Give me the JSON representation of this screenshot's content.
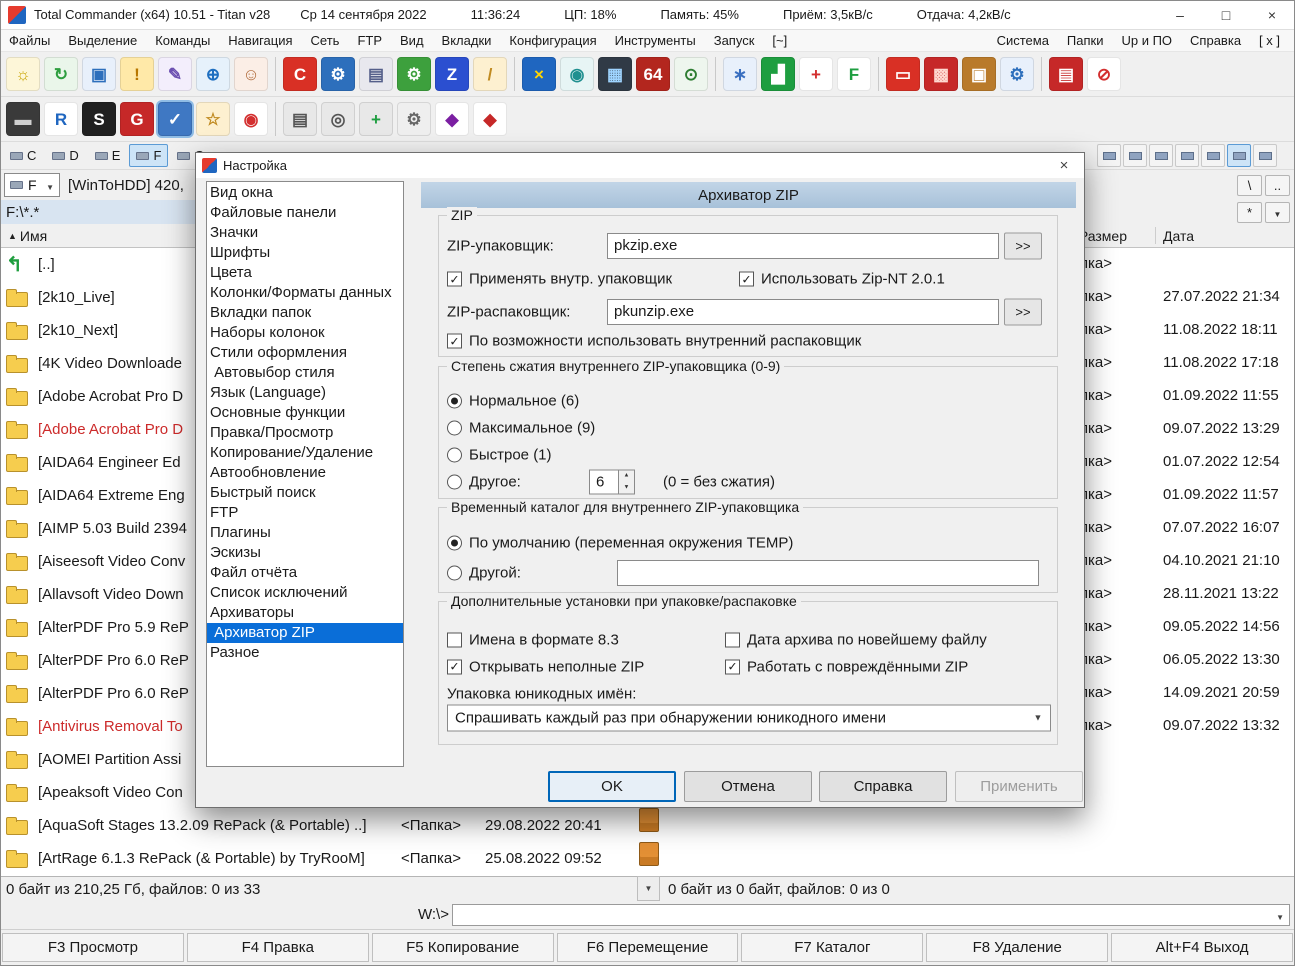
{
  "colors": {
    "accent": "#0a6ed8",
    "selection_bg": "#0a6ed8",
    "dialog_header": "#aec6dc",
    "folder_yellow": "#f6cd4e",
    "red_item": "#cc2a2a"
  },
  "titlebar": {
    "title": "Total Commander (x64) 10.51 - Titan v28",
    "date": "Ср 14 сентября 2022",
    "time": "11:36:24",
    "cpu": "ЦП: 18%",
    "memory": "Память: 45%",
    "rx": "Приём: 3,5кВ/с",
    "tx": "Отдача: 4,2кВ/с",
    "minimize": "–",
    "maximize": "□",
    "close": "×"
  },
  "menubar": {
    "left": [
      "Файлы",
      "Выделение",
      "Команды",
      "Навигация",
      "Сеть",
      "FTP",
      "Вид",
      "Вкладки",
      "Конфигурация",
      "Инструменты",
      "Запуск",
      "[~]"
    ],
    "right": [
      "Система",
      "Папки",
      "Up и ПО",
      "Справка",
      "[ x ]"
    ]
  },
  "toolbar1": [
    {
      "name": "lightbulb-icon",
      "glyph": "☼",
      "bg": "#fdf6d8",
      "fg": "#c9a400"
    },
    {
      "name": "refresh-icon",
      "glyph": "↻",
      "bg": "#eaf6ea",
      "fg": "#2e9e3f"
    },
    {
      "name": "monitor-icon",
      "glyph": "▣",
      "bg": "#e8f0fb",
      "fg": "#2d6fbc"
    },
    {
      "name": "shield-warning-icon",
      "glyph": "!",
      "bg": "#ffe9a8",
      "fg": "#b87700"
    },
    {
      "name": "pen-icon",
      "glyph": "✎",
      "bg": "#f3eefc",
      "fg": "#6b4fb0"
    },
    {
      "name": "globe-icon",
      "glyph": "⊕",
      "bg": "#e6f1fb",
      "fg": "#1f6fc0"
    },
    {
      "name": "user-icon",
      "glyph": "☺",
      "bg": "#fbeee6",
      "fg": "#b06a3a"
    },
    {
      "name": "ccleaner-icon",
      "glyph": "C",
      "bg": "#d93025",
      "fg": "#ffffff",
      "sep": true
    },
    {
      "name": "gear-blue-icon",
      "glyph": "⚙",
      "bg": "#2d6fbc",
      "fg": "#ffffff"
    },
    {
      "name": "printer-icon",
      "glyph": "▤",
      "bg": "#e8e8ee",
      "fg": "#555f8a"
    },
    {
      "name": "green-tool-icon",
      "glyph": "⚙",
      "bg": "#3da03d",
      "fg": "#ffffff"
    },
    {
      "name": "zip-z-icon",
      "glyph": "Z",
      "bg": "#2b4fd0",
      "fg": "#ffffff"
    },
    {
      "name": "broom-icon",
      "glyph": "/",
      "bg": "#fdf0d0",
      "fg": "#c08a20"
    },
    {
      "name": "block-x-icon",
      "glyph": "×",
      "bg": "#1f66c0",
      "fg": "#ffd400",
      "sep": true
    },
    {
      "name": "gauge-icon",
      "glyph": "◉",
      "bg": "#e7f5f5",
      "fg": "#1f8f8f"
    },
    {
      "name": "cpu-chip-icon",
      "glyph": "▦",
      "bg": "#303a46",
      "fg": "#9fd4ff"
    },
    {
      "name": "aida64-icon",
      "glyph": "64",
      "bg": "#b3261e",
      "fg": "#ffffff"
    },
    {
      "name": "hardware-search-icon",
      "glyph": "⊙",
      "bg": "#eef6ee",
      "fg": "#2e7d32"
    },
    {
      "name": "wand-icon",
      "glyph": "∗",
      "bg": "#e8f0fb",
      "fg": "#3a6fc0",
      "sep": true
    },
    {
      "name": "bar-chart-icon",
      "glyph": "▟",
      "bg": "#1e9e40",
      "fg": "#ffffff"
    },
    {
      "name": "medical-cross-icon",
      "glyph": "+",
      "bg": "#ffffff",
      "fg": "#d32f2f"
    },
    {
      "name": "letter-f-icon",
      "glyph": "F",
      "bg": "#ffffff",
      "fg": "#1e9e40"
    },
    {
      "name": "red-panel-icon",
      "glyph": "▭",
      "bg": "#d93025",
      "fg": "#ffffff",
      "sep": true
    },
    {
      "name": "red-blocks-icon",
      "glyph": "▩",
      "bg": "#c62828",
      "fg": "#ffd8d0"
    },
    {
      "name": "toolbox-icon",
      "glyph": "▣",
      "bg": "#b97a2a",
      "fg": "#ffffff"
    },
    {
      "name": "gears-pair-icon",
      "glyph": "⚙",
      "bg": "#e8f0fb",
      "fg": "#2d6fbc"
    },
    {
      "name": "brick-wall-icon",
      "glyph": "▤",
      "bg": "#c62828",
      "fg": "#ffffff",
      "sep": true
    },
    {
      "name": "no-entry-icon",
      "glyph": "⊘",
      "bg": "#ffffff",
      "fg": "#d32f2f"
    }
  ],
  "toolbar2": [
    {
      "name": "dark-case-icon",
      "glyph": "▬",
      "bg": "#3a3a3a",
      "fg": "#d0d0d0"
    },
    {
      "name": "r-studio-icon",
      "glyph": "R",
      "bg": "#ffffff",
      "fg": "#1f66c0"
    },
    {
      "name": "sd-tool-icon",
      "glyph": "S",
      "bg": "#202020",
      "fg": "#ffffff"
    },
    {
      "name": "g-red-icon",
      "glyph": "G",
      "bg": "#c62828",
      "fg": "#ffffff"
    },
    {
      "name": "check-panel-icon",
      "glyph": "✓",
      "bg": "#3f78c3",
      "fg": "#ffffff",
      "pressed": true
    },
    {
      "name": "sparkle-wand-icon",
      "glyph": "☆",
      "bg": "#fdf0d0",
      "fg": "#c08a20"
    },
    {
      "name": "orbs-icon",
      "glyph": "◉",
      "bg": "#ffffff",
      "fg": "#d32f2f"
    },
    {
      "name": "drives-icon",
      "glyph": "▤",
      "bg": "#e8e8e8",
      "fg": "#555555",
      "sep": true
    },
    {
      "name": "drive-disc-icon",
      "glyph": "◎",
      "bg": "#e8e8e8",
      "fg": "#555555"
    },
    {
      "name": "drive-add-icon",
      "glyph": "+",
      "bg": "#e8e8e8",
      "fg": "#1e9e40"
    },
    {
      "name": "gray-gears-icon",
      "glyph": "⚙",
      "bg": "#efefef",
      "fg": "#666666"
    },
    {
      "name": "color-cube-icon",
      "glyph": "◆",
      "bg": "#ffffff",
      "fg": "#7b1fa2"
    },
    {
      "name": "red-stack-icon",
      "glyph": "◆",
      "bg": "#ffffff",
      "fg": "#c62828"
    }
  ],
  "drivebar": {
    "drives": [
      {
        "letter": "C",
        "name": "drive-c-button"
      },
      {
        "letter": "D",
        "name": "drive-d-button"
      },
      {
        "letter": "E",
        "name": "drive-e-button"
      },
      {
        "letter": "F",
        "name": "drive-f-button",
        "active": true
      },
      {
        "letter": "G",
        "name": "drive-g-button"
      }
    ],
    "right_buttons": [
      {},
      {},
      {},
      {},
      {},
      {
        "active": true
      },
      {}
    ]
  },
  "left_panel": {
    "drive": "F",
    "drive_info": "[WinToHDD] 420,",
    "path": "F:\\*.*",
    "header": {
      "sort": "▲",
      "name": "Имя"
    },
    "rows": [
      {
        "updir": true,
        "name": "[..]",
        "size": "",
        "date": ""
      },
      {
        "name": "[2k10_Live]",
        "size": "",
        "date": ""
      },
      {
        "name": "[2k10_Next]",
        "size": "",
        "date": ""
      },
      {
        "name": "[4K Video Downloade",
        "size": "",
        "date": ""
      },
      {
        "name": "[Adobe Acrobat Pro D",
        "size": "",
        "date": ""
      },
      {
        "name": "[Adobe Acrobat Pro D",
        "red": true,
        "size": "",
        "date": ""
      },
      {
        "name": "[AIDA64 Engineer Ed",
        "size": "",
        "date": ""
      },
      {
        "name": "[AIDA64 Extreme Eng",
        "size": "",
        "date": ""
      },
      {
        "name": "[AIMP 5.03 Build 2394",
        "size": "",
        "date": ""
      },
      {
        "name": "[Aiseesoft Video Conv",
        "size": "",
        "date": ""
      },
      {
        "name": "[Allavsoft Video Down",
        "size": "",
        "date": ""
      },
      {
        "name": "[AlterPDF Pro 5.9 ReP",
        "size": "",
        "date": ""
      },
      {
        "name": "[AlterPDF Pro 6.0 ReP",
        "size": "",
        "date": ""
      },
      {
        "name": "[AlterPDF Pro 6.0 ReP",
        "size": "",
        "date": ""
      },
      {
        "name": "[Antivirus Removal To",
        "red": true,
        "size": "",
        "date": ""
      },
      {
        "name": "[AOMEI Partition Assi",
        "size": "",
        "date": ""
      },
      {
        "name": "[Apeaksoft Video Con",
        "size": "",
        "date": ""
      },
      {
        "name": "[AquaSoft Stages 13.2.09 RePack (& Portable) ..]",
        "size": "<Папка>",
        "date": "29.08.2022 20:41"
      },
      {
        "name": "[ArtRage 6.1.3 RePack (& Portable) by TryRooM]",
        "size": "<Папка>",
        "date": "25.08.2022 09:52"
      }
    ],
    "status": "0 байт из 210,25 Гб, файлов: 0 из 33"
  },
  "right_panel": {
    "root_btn": "\\",
    "up_btn": "..",
    "fav_btn": "*",
    "header": {
      "size": "Размер",
      "date": "Дата"
    },
    "rows": [
      {
        "size": "<Папка>",
        "date": ""
      },
      {
        "size": "<Папка>",
        "date": "27.07.2022 21:34"
      },
      {
        "size": "<Папка>",
        "date": "11.08.2022 18:11"
      },
      {
        "size": "<Папка>",
        "date": "11.08.2022 17:18"
      },
      {
        "size": "<Папка>",
        "date": "01.09.2022 11:55"
      },
      {
        "size": "<Папка>",
        "date": "09.07.2022 13:29"
      },
      {
        "size": "<Папка>",
        "date": "01.07.2022 12:54"
      },
      {
        "size": "<Папка>",
        "date": "01.09.2022 11:57"
      },
      {
        "size": "<Папка>",
        "date": "07.07.2022 16:07"
      },
      {
        "size": "<Папка>",
        "date": "04.10.2021 21:10"
      },
      {
        "size": "<Папка>",
        "date": "28.11.2021 13:22"
      },
      {
        "size": "<Папка>",
        "date": "09.05.2022 14:56"
      },
      {
        "size": "<Папка>",
        "date": "06.05.2022 13:30"
      },
      {
        "size": "<Папка>",
        "date": "14.09.2021 20:59"
      },
      {
        "size": "<Папка>",
        "date": "09.07.2022 13:32"
      }
    ],
    "status": "0 байт из 0 байт, файлов: 0 из 0"
  },
  "cmdline": {
    "prompt": "W:\\>",
    "value": ""
  },
  "fkeys": [
    "F3 Просмотр",
    "F4 Правка",
    "F5 Копирование",
    "F6 Перемещение",
    "F7 Каталог",
    "F8 Удаление",
    "Alt+F4 Выход"
  ],
  "dialog": {
    "title": "Настройка",
    "close": "×",
    "header": "Архиватор ZIP",
    "categories": [
      {
        "label": "Вид окна"
      },
      {
        "label": "Файловые панели"
      },
      {
        "label": "Значки"
      },
      {
        "label": "Шрифты"
      },
      {
        "label": "Цвета"
      },
      {
        "label": "Колонки/Форматы данных"
      },
      {
        "label": "Вкладки папок"
      },
      {
        "label": "Наборы колонок"
      },
      {
        "label": "Стили оформления"
      },
      {
        "label": " Автовыбор стиля"
      },
      {
        "label": "Язык (Language)"
      },
      {
        "label": "Основные функции"
      },
      {
        "label": "Правка/Просмотр"
      },
      {
        "label": "Копирование/Удаление"
      },
      {
        "label": "Автообновление"
      },
      {
        "label": "Быстрый поиск"
      },
      {
        "label": "FTP"
      },
      {
        "label": "Плагины"
      },
      {
        "label": "Эскизы"
      },
      {
        "label": "Файл отчёта"
      },
      {
        "label": "Список исключений"
      },
      {
        "label": "Архиваторы"
      },
      {
        "label": " Архиватор ZIP",
        "selected": true
      },
      {
        "label": "Разное"
      }
    ],
    "zip_group": {
      "legend": "ZIP",
      "packer_label": "ZIP-упаковщик:",
      "packer_value": "pkzip.exe",
      "browse": ">>",
      "use_internal_packer": {
        "label": "Применять внутр. упаковщик",
        "checked": true
      },
      "use_zipnt": {
        "label": "Использовать Zip-NT 2.0.1",
        "checked": true
      },
      "unpacker_label": "ZIP-распаковщик:",
      "unpacker_value": "pkunzip.exe",
      "use_internal_unpacker": {
        "label": "По возможности использовать внутренний распаковщик",
        "checked": true
      }
    },
    "compression_group": {
      "legend": "Степень сжатия внутреннего ZIP-упаковщика (0-9)",
      "normal": "Нормальное (6)",
      "max": "Максимальное (9)",
      "fast": "Быстрое (1)",
      "other": "Другое:",
      "other_value": "6",
      "note": "(0 = без сжатия)",
      "selected": "Нормальное (6)"
    },
    "temp_group": {
      "legend": "Временный каталог для внутреннего ZIP-упаковщика",
      "default_label": "По умолчанию (переменная окружения TEMP)",
      "other_label": "Другой:",
      "other_value": "",
      "selected": "По умолчанию (переменная окружения TEMP)"
    },
    "extra_group": {
      "legend": "Дополнительные установки при упаковке/распаковке",
      "names83": {
        "label": "Имена в формате 8.3",
        "checked": false
      },
      "by_newest": {
        "label": "Дата архива по новейшему файлу",
        "checked": false
      },
      "open_partial": {
        "label": "Открывать неполные ZIP",
        "checked": true
      },
      "damaged": {
        "label": "Работать с повреждёнными ZIP",
        "checked": true
      },
      "unicode_label": "Упаковка юникодных имён:",
      "unicode_value": "Спрашивать каждый раз при обнаружении юникодного имени"
    },
    "buttons": {
      "ok": "OK",
      "cancel": "Отмена",
      "help": "Справка",
      "apply": "Применить"
    }
  }
}
